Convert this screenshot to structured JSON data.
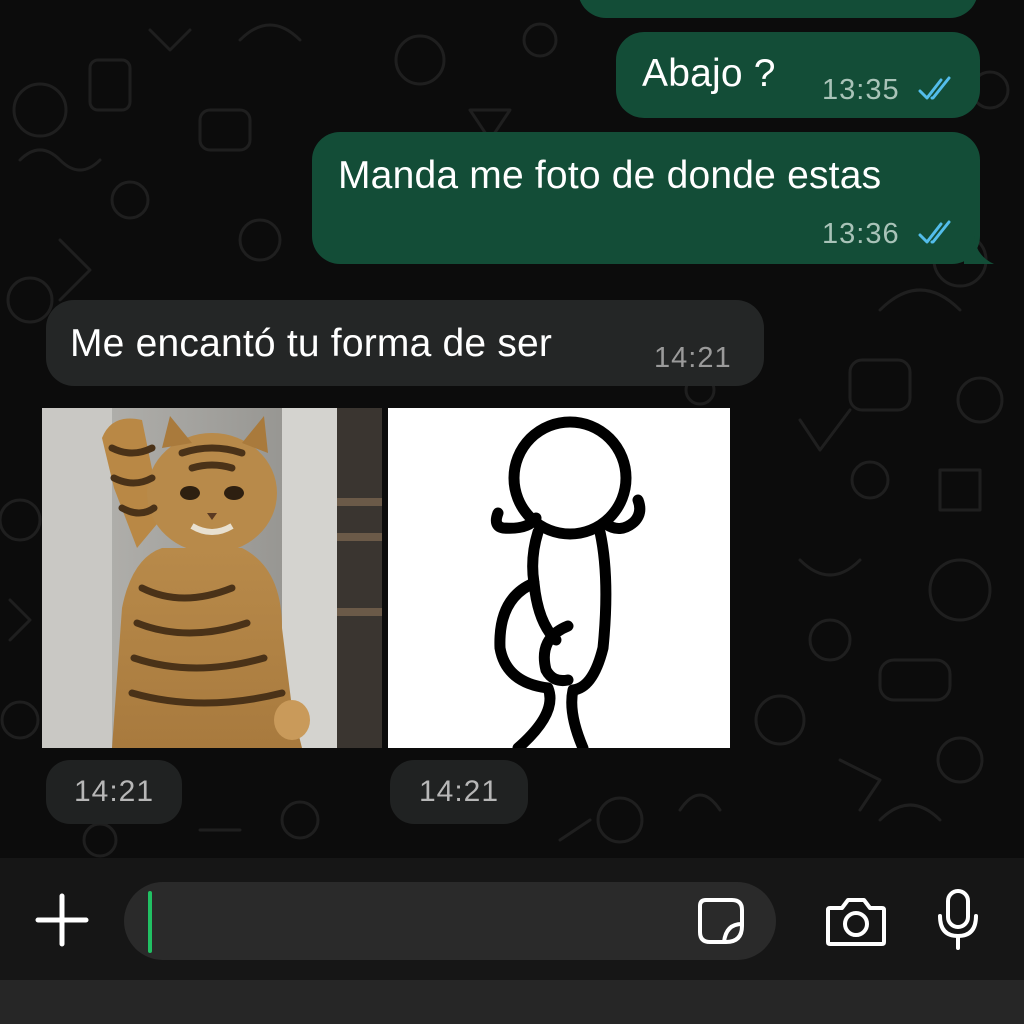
{
  "chat": {
    "messages": [
      {
        "direction": "outgoing",
        "text": "Abajo ?",
        "time": "13:35",
        "status": "read"
      },
      {
        "direction": "outgoing",
        "text": "Manda me foto de donde estas",
        "time": "13:36",
        "status": "read"
      },
      {
        "direction": "incoming",
        "text": "Me encantó tu forma de ser",
        "time": "14:21"
      },
      {
        "direction": "incoming",
        "type": "image",
        "description": "cat-sticker",
        "time": "14:21"
      },
      {
        "direction": "incoming",
        "type": "image",
        "description": "stick-figure-sticker",
        "time": "14:21"
      }
    ]
  },
  "composer": {
    "input_value": "",
    "icons": [
      "plus-icon",
      "sticker-icon",
      "camera-icon",
      "microphone-icon"
    ]
  },
  "colors": {
    "outgoing_bubble": "#134d37",
    "incoming_bubble": "#242626",
    "read_ticks": "#53bdeb",
    "caret": "#21c063",
    "background": "#0c0c0c"
  }
}
